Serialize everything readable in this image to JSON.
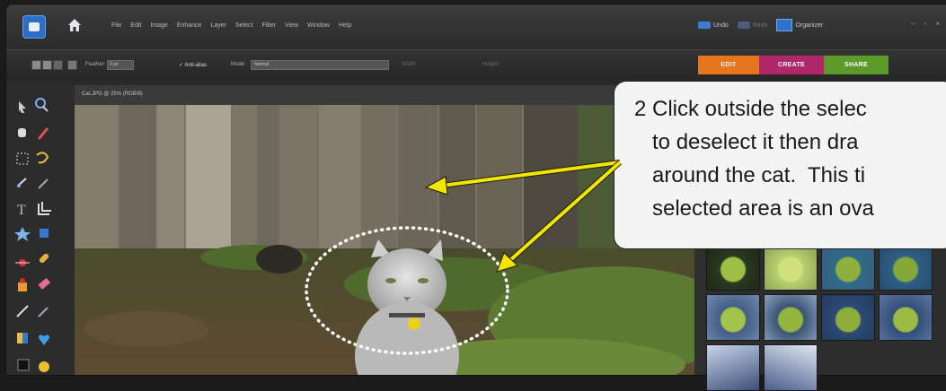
{
  "menubar": {
    "items": [
      "File",
      "Edit",
      "Image",
      "Enhance",
      "Layer",
      "Select",
      "Filter",
      "View",
      "Window",
      "Help"
    ],
    "undo_label": "Undo",
    "redo_label": "Redo",
    "organizer_label": "Organizer",
    "window_controls": [
      "–",
      "▫",
      "×"
    ]
  },
  "options_bar": {
    "feather_label": "Feather:",
    "feather_value": "0 px",
    "antialias_label": "Anti-alias",
    "mode_label": "Mode:",
    "mode_value": "Normal",
    "width_label": "Width:",
    "height_label": "Height:"
  },
  "mode_tabs": [
    {
      "label": "EDIT",
      "color": "#e6761e"
    },
    {
      "label": "CREATE",
      "color": "#b0286a"
    },
    {
      "label": "SHARE",
      "color": "#5c9a2a"
    }
  ],
  "document": {
    "title": "Cat.JPG @ 25% (RGB/8)"
  },
  "callout": {
    "text": "2 Click outside the selec\n   to deselect it then dra\n   around the cat.  This ti\n   selected area is an ova"
  },
  "icons": {
    "app": "elements-logo-icon",
    "home": "home-icon"
  },
  "colors": {
    "arrow": "#f2e600",
    "selection": "#ffffff"
  }
}
